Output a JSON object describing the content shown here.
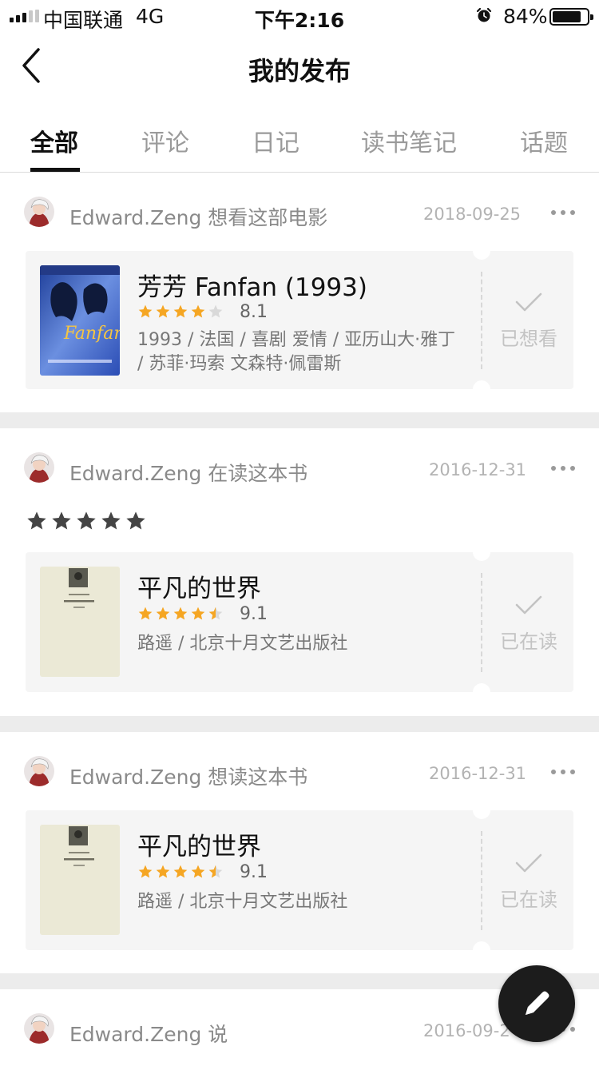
{
  "status_bar": {
    "carrier": "中国联通",
    "network": "4G",
    "time": "下午2:16",
    "battery": "84%",
    "battery_level": 0.84
  },
  "nav": {
    "title": "我的发布"
  },
  "tabs": [
    {
      "label": "全部",
      "active": true
    },
    {
      "label": "评论",
      "active": false
    },
    {
      "label": "日记",
      "active": false
    },
    {
      "label": "读书笔记",
      "active": false
    },
    {
      "label": "话题",
      "active": false
    }
  ],
  "posts": [
    {
      "author": "Edward.Zeng",
      "action": "想看这部电影",
      "date": "2018-09-25",
      "item": {
        "title": "芳芳 Fanfan (1993)",
        "rating": "8.1",
        "stars": 4,
        "info": "1993 / 法国 / 喜剧 爱情 / 亚历山大·雅丁 / 苏菲·玛索 文森特·佩雷斯",
        "status": "已想看",
        "cover_text": "Fanfan"
      }
    },
    {
      "author": "Edward.Zeng",
      "action": "在读这本书",
      "date": "2016-12-31",
      "user_stars": 5,
      "item": {
        "title": "平凡的世界",
        "rating": "9.1",
        "stars": 4.5,
        "info": "路遥 / 北京十月文艺出版社",
        "status": "已在读"
      }
    },
    {
      "author": "Edward.Zeng",
      "action": "想读这本书",
      "date": "2016-12-31",
      "item": {
        "title": "平凡的世界",
        "rating": "9.1",
        "stars": 4.5,
        "info": "路遥 / 北京十月文艺出版社",
        "status": "已在读"
      }
    },
    {
      "author": "Edward.Zeng",
      "action": "说",
      "date": "2016-09-2"
    }
  ],
  "colors": {
    "star": "#f5a623",
    "star_empty": "#d9d9d9",
    "user_star": "#444444",
    "separator": "#ececec",
    "card_bg": "#f5f5f5"
  }
}
